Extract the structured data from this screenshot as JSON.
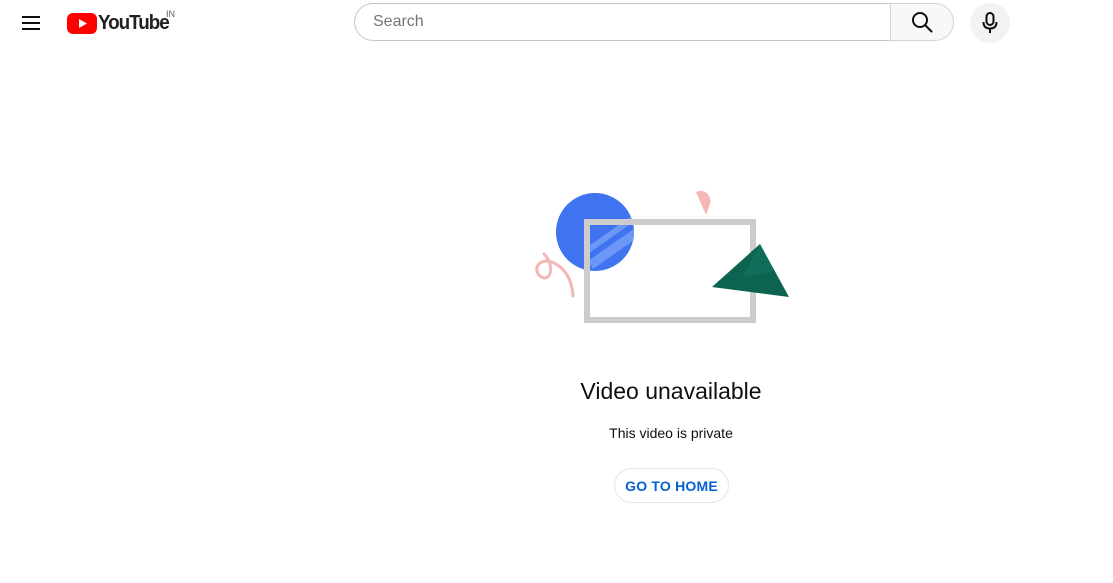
{
  "masthead": {
    "menu_icon": "hamburger-menu-icon",
    "logo_icon": "youtube-play-logo-icon",
    "logo_text": "YouTube",
    "country_code": "IN",
    "search": {
      "placeholder": "Search",
      "value": ""
    },
    "search_icon": "search-icon",
    "mic_icon": "microphone-icon"
  },
  "error": {
    "illustration": "video-unavailable-illustration",
    "title": "Video unavailable",
    "message": "This video is private",
    "home_button_label": "GO TO HOME"
  },
  "colors": {
    "brand_red": "#ff0000",
    "link_blue": "#065fd4",
    "illustration_blue": "#3f73f0",
    "illustration_green": "#0b6350",
    "illustration_pink": "#f4b7b7",
    "illustration_frame": "#cccccc"
  }
}
